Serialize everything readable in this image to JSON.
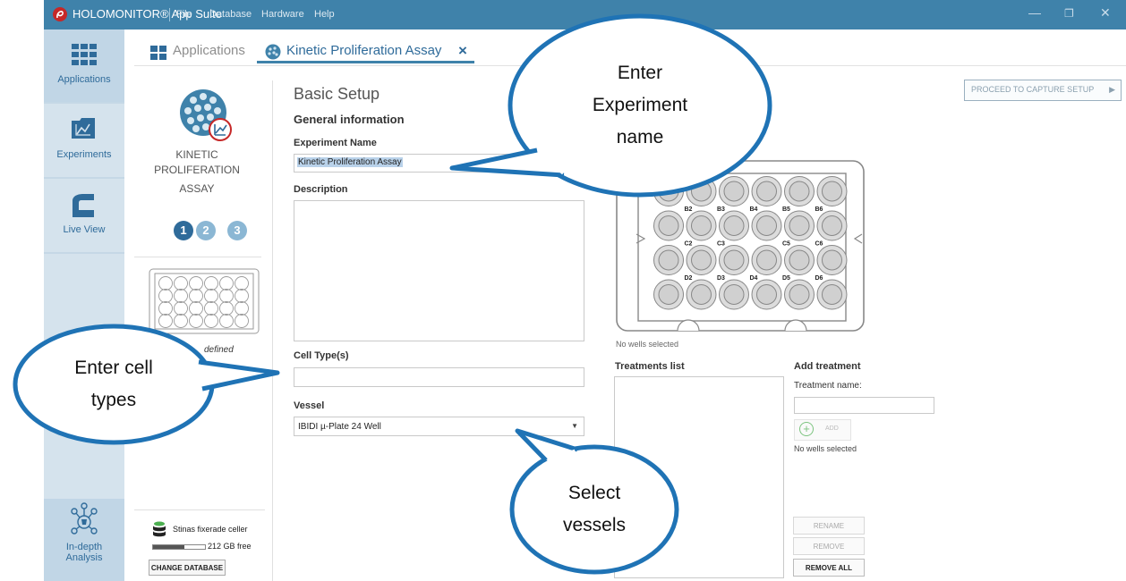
{
  "titlebar": {
    "app_name": "HOLOMONITOR® App Suite",
    "menu": [
      "File",
      "Database",
      "Hardware",
      "Help"
    ]
  },
  "sidebar": {
    "items": [
      {
        "label": "Applications",
        "icon": "grid-icon"
      },
      {
        "label": "Experiments",
        "icon": "chart-folder-icon"
      },
      {
        "label": "Live View",
        "icon": "microscope-icon"
      }
    ],
    "bottom_item": {
      "line1": "In-depth",
      "line2": "Analysis",
      "icon": "analysis-icon"
    }
  },
  "tabs": {
    "applications": "Applications",
    "active": "Kinetic Proliferation Assay",
    "close": "×"
  },
  "assay": {
    "line1": "KINETIC",
    "line2": "PROLIFERATION",
    "line3": "ASSAY",
    "steps": [
      "1",
      "2",
      "3"
    ],
    "plate_caption": "defined"
  },
  "database": {
    "name": "Stinas fixerade celler",
    "free": "212 GB free",
    "change_button": "CHANGE DATABASE",
    "used_fraction": 0.6
  },
  "form": {
    "heading": "Basic Setup",
    "subheading": "General information",
    "experiment_name_label": "Experiment Name",
    "experiment_name_value": "Kinetic Proliferation Assay",
    "description_label": "Description",
    "cell_types_label": "Cell Type(s)",
    "vessel_label": "Vessel",
    "vessel_value": "IBIDI µ-Plate 24 Well"
  },
  "proceed_button": "PROCEED TO CAPTURE SETUP",
  "plate": {
    "wells_status": "No wells selected",
    "labels": [
      "B2",
      "B3",
      "B4",
      "B5",
      "B6",
      "C2",
      "C3",
      "C5",
      "C6",
      "D2",
      "D3",
      "D4",
      "D5",
      "D6"
    ]
  },
  "treatments": {
    "list_label": "Treatments list",
    "add_label": "Add treatment",
    "name_label": "Treatment name:",
    "add_button": "ADD",
    "status": "No wells selected",
    "rename": "RENAME",
    "remove": "REMOVE",
    "remove_all": "REMOVE ALL"
  },
  "callouts": {
    "experiment": [
      "Enter",
      "Experiment",
      "name"
    ],
    "cell_types": [
      "Enter cell",
      "types"
    ],
    "vessels": [
      "Select",
      "vessels"
    ]
  },
  "colors": {
    "accent": "#3f82aa",
    "sidebar": "#d5e3ed",
    "callout_fill": "#1f73b5"
  }
}
